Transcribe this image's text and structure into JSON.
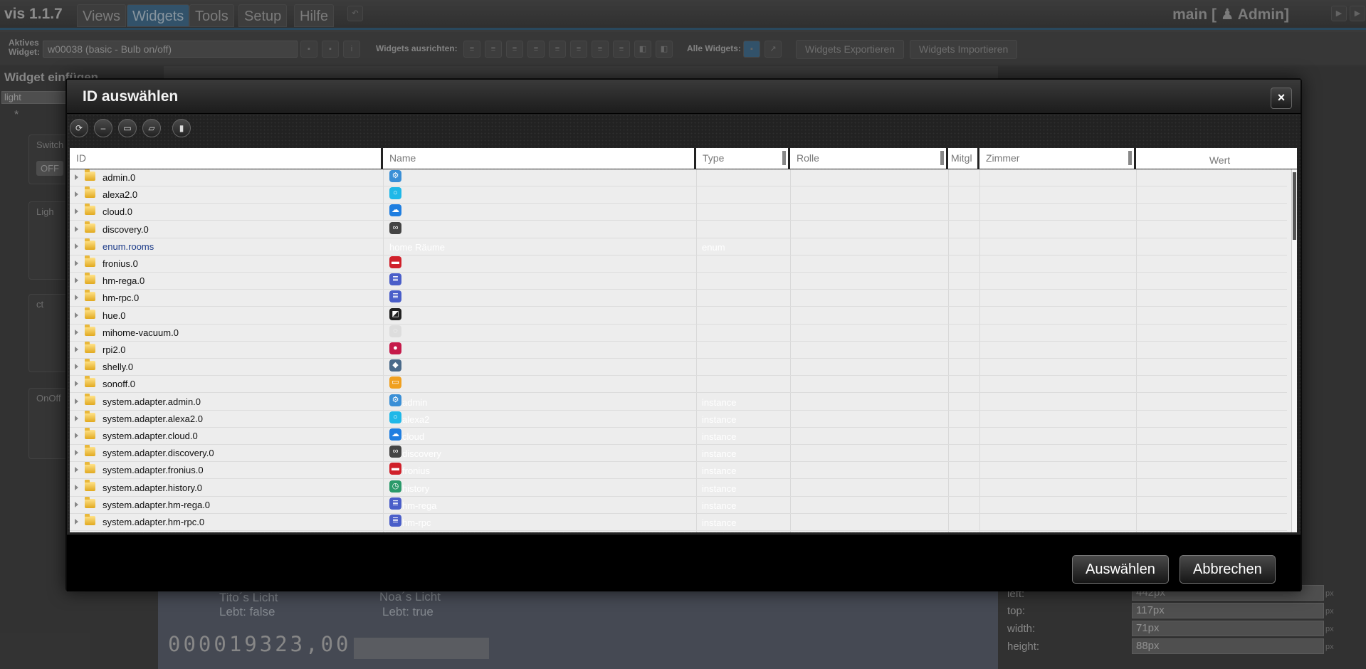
{
  "app": {
    "title": "vis 1.1.7",
    "menu_tabs": [
      "Views",
      "Widgets",
      "Tools",
      "Setup",
      "Hilfe"
    ],
    "active_tab": "Widgets",
    "project": "main [",
    "user": "Admin]"
  },
  "toolbar": {
    "active_widget_label_1": "Aktives",
    "active_widget_label_2": "Widget:",
    "active_widget_value": "w00038 (basic - Bulb on/off)",
    "align_label": "Widgets ausrichten:",
    "all_widgets_label": "Alle Widgets:",
    "export_label": "Widgets Exportieren",
    "import_label": "Widgets Importieren"
  },
  "left_panel": {
    "title": "Widget einfügen",
    "filter_value": "light",
    "cards": [
      "Switch",
      "Ligh",
      "ct",
      "OnOff"
    ],
    "switch_value": "OFF"
  },
  "canvas": {
    "light1_name": "Tito´s Licht",
    "light1_status": "Lebt: false",
    "light2_name": "Noa´s Licht",
    "light2_status": "Lebt: true",
    "counter": "000019323,00"
  },
  "right_panel": {
    "fields": [
      {
        "label": "left:",
        "value": "442px"
      },
      {
        "label": "top:",
        "value": "117px"
      },
      {
        "label": "width:",
        "value": "71px"
      },
      {
        "label": "height:",
        "value": "88px"
      }
    ],
    "unit": "px"
  },
  "dialog": {
    "title": "ID auswählen",
    "close_glyph": "×",
    "columns": {
      "id": "ID",
      "name": "Name",
      "type": "Type",
      "role": "Rolle",
      "members": "Mitgl",
      "room": "Zimmer",
      "value": "Wert"
    },
    "rows": [
      {
        "id": "admin.0",
        "icon": "admin-icon",
        "color": "#3a8fd6",
        "name": "",
        "type": ""
      },
      {
        "id": "alexa2.0",
        "icon": "alexa-icon",
        "color": "#1fb8e8",
        "name": "",
        "type": ""
      },
      {
        "id": "cloud.0",
        "icon": "cloud-icon",
        "color": "#1f7ee0",
        "name": "",
        "type": ""
      },
      {
        "id": "discovery.0",
        "icon": "binoculars-icon",
        "color": "#444444",
        "name": "",
        "type": ""
      },
      {
        "id": "enum.rooms",
        "icon": "",
        "color": "",
        "name": "home Räume",
        "type": "enum",
        "link": true
      },
      {
        "id": "fronius.0",
        "icon": "fronius-icon",
        "color": "#d0202a",
        "name": "",
        "type": ""
      },
      {
        "id": "hm-rega.0",
        "icon": "homematic-icon",
        "color": "#4a5ec9",
        "name": "",
        "type": ""
      },
      {
        "id": "hm-rpc.0",
        "icon": "homematic-icon",
        "color": "#4a5ec9",
        "name": "",
        "type": ""
      },
      {
        "id": "hue.0",
        "icon": "hue-icon",
        "color": "#222222",
        "name": "",
        "type": ""
      },
      {
        "id": "mihome-vacuum.0",
        "icon": "vacuum-icon",
        "color": "#dddddd",
        "name": "",
        "type": ""
      },
      {
        "id": "rpi2.0",
        "icon": "raspberry-icon",
        "color": "#c51a4a",
        "name": "",
        "type": ""
      },
      {
        "id": "shelly.0",
        "icon": "shelly-icon",
        "color": "#4a6a8a",
        "name": "",
        "type": ""
      },
      {
        "id": "sonoff.0",
        "icon": "sonoff-icon",
        "color": "#f0a020",
        "name": "",
        "type": ""
      },
      {
        "id": "system.adapter.admin.0",
        "icon": "admin-icon",
        "color": "#3a8fd6",
        "name": "admin",
        "type": "instance"
      },
      {
        "id": "system.adapter.alexa2.0",
        "icon": "alexa-icon",
        "color": "#1fb8e8",
        "name": "alexa2",
        "type": "instance"
      },
      {
        "id": "system.adapter.cloud.0",
        "icon": "cloud-icon",
        "color": "#1f7ee0",
        "name": "cloud",
        "type": "instance"
      },
      {
        "id": "system.adapter.discovery.0",
        "icon": "binoculars-icon",
        "color": "#444444",
        "name": "discovery",
        "type": "instance"
      },
      {
        "id": "system.adapter.fronius.0",
        "icon": "fronius-icon",
        "color": "#d0202a",
        "name": "fronius",
        "type": "instance"
      },
      {
        "id": "system.adapter.history.0",
        "icon": "history-icon",
        "color": "#2a9a6a",
        "name": "history",
        "type": "instance"
      },
      {
        "id": "system.adapter.hm-rega.0",
        "icon": "homematic-icon",
        "color": "#4a5ec9",
        "name": "hm-rega",
        "type": "instance"
      },
      {
        "id": "system.adapter.hm-rpc.0",
        "icon": "homematic-icon",
        "color": "#4a5ec9",
        "name": "hm-rpc",
        "type": "instance"
      }
    ],
    "select_label": "Auswählen",
    "cancel_label": "Abbrechen"
  }
}
